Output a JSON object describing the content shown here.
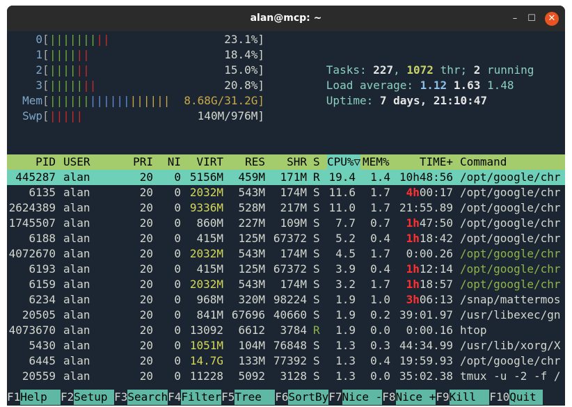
{
  "window": {
    "title": "alan@mcp: ~",
    "minimize": "–",
    "maximize": "☐",
    "close": "✕"
  },
  "meters": {
    "cpu": [
      {
        "id": "0",
        "green": "|||||||",
        "red": "||",
        "value": "23.1%]"
      },
      {
        "id": "1",
        "green": "||||",
        "red": "||",
        "value": "18.4%]"
      },
      {
        "id": "2",
        "green": "||||",
        "red": "||",
        "value": "15.0%]"
      },
      {
        "id": "3",
        "green": "|||||",
        "red": "||",
        "value": "20.8%]"
      }
    ],
    "mem": {
      "label": "Mem",
      "bar": "||||||||||||||||||",
      "value": "8.68G/31.2G]"
    },
    "swp": {
      "label": "Swp",
      "bar": "|||||",
      "value": "140M/976M]"
    }
  },
  "summary": {
    "tasks_label": "Tasks: ",
    "tasks": "227",
    "sep1": ", ",
    "threads": "1072",
    "thr": " thr; ",
    "running": "2",
    "running_label": " running",
    "load_label": "Load average: ",
    "load1": "1.12",
    "load5": "1.63",
    "load15": "1.48",
    "uptime_label": "Uptime: ",
    "uptime": "7 days, 21:10:47"
  },
  "columns": [
    "PID",
    "USER",
    "PRI",
    "NI",
    "VIRT",
    "RES",
    "SHR",
    "S",
    "CPU%▽",
    "MEM%",
    "TIME+",
    "Command"
  ],
  "processes": [
    {
      "pid": "445287",
      "user": "alan",
      "pri": "20",
      "ni": "0",
      "virt": "5156M",
      "res": "459M",
      "shr": "171M",
      "s": "R",
      "cpu": "19.4",
      "mem": "1.4",
      "time_a": "10h48:56",
      "time_b": "",
      "cmd": "/opt/google/chr"
    },
    {
      "pid": "6135",
      "user": "alan",
      "pri": "20",
      "ni": "0",
      "virt": "2032M",
      "res": "543M",
      "shr": "174M",
      "s": "S",
      "cpu": "11.6",
      "mem": "1.7",
      "time_a": "4h",
      "time_b": "00:17",
      "cmd": "/opt/google/chr"
    },
    {
      "pid": "2624389",
      "user": "alan",
      "pri": "20",
      "ni": "0",
      "virt": "9336M",
      "res": "528M",
      "shr": "217M",
      "s": "S",
      "cpu": "11.0",
      "mem": "1.7",
      "time_a": "",
      "time_b": "21:55.89",
      "cmd": "/opt/google/chr"
    },
    {
      "pid": "1745507",
      "user": "alan",
      "pri": "20",
      "ni": "0",
      "virt": "860M",
      "res": "227M",
      "shr": "109M",
      "s": "S",
      "cpu": "7.7",
      "mem": "0.7",
      "time_a": "1h",
      "time_b": "47:50",
      "cmd": "/opt/google/chr"
    },
    {
      "pid": "6188",
      "user": "alan",
      "pri": "20",
      "ni": "0",
      "virt": "415M",
      "res": "125M",
      "shr": "67372",
      "s": "S",
      "cpu": "5.2",
      "mem": "0.4",
      "time_a": "1h",
      "time_b": "18:42",
      "cmd": "/opt/google/chr"
    },
    {
      "pid": "4072670",
      "user": "alan",
      "pri": "20",
      "ni": "0",
      "virt": "2032M",
      "res": "543M",
      "shr": "174M",
      "s": "S",
      "cpu": "4.5",
      "mem": "1.7",
      "time_a": "",
      "time_b": "0:00.26",
      "cmd": "/opt/google/chr"
    },
    {
      "pid": "6193",
      "user": "alan",
      "pri": "20",
      "ni": "0",
      "virt": "415M",
      "res": "125M",
      "shr": "67372",
      "s": "S",
      "cpu": "3.9",
      "mem": "0.4",
      "time_a": "1h",
      "time_b": "12:14",
      "cmd": "/opt/google/chr"
    },
    {
      "pid": "6159",
      "user": "alan",
      "pri": "20",
      "ni": "0",
      "virt": "2032M",
      "res": "543M",
      "shr": "174M",
      "s": "S",
      "cpu": "3.2",
      "mem": "1.7",
      "time_a": "1h",
      "time_b": "18:57",
      "cmd": "/opt/google/chr"
    },
    {
      "pid": "6234",
      "user": "alan",
      "pri": "20",
      "ni": "0",
      "virt": "968M",
      "res": "320M",
      "shr": "98224",
      "s": "S",
      "cpu": "1.9",
      "mem": "1.0",
      "time_a": "3h",
      "time_b": "06:13",
      "cmd": "/snap/mattermos"
    },
    {
      "pid": "20505",
      "user": "alan",
      "pri": "20",
      "ni": "0",
      "virt": "841M",
      "res": "67696",
      "shr": "40660",
      "s": "S",
      "cpu": "1.9",
      "mem": "0.2",
      "time_a": "",
      "time_b": "39:01.97",
      "cmd": "/usr/libexec/gn"
    },
    {
      "pid": "4073670",
      "user": "alan",
      "pri": "20",
      "ni": "0",
      "virt": "13092",
      "res": "6612",
      "shr": "3784",
      "s": "R",
      "cpu": "1.9",
      "mem": "0.0",
      "time_a": "",
      "time_b": "0:00.16",
      "cmd": "htop"
    },
    {
      "pid": "5430",
      "user": "alan",
      "pri": "20",
      "ni": "0",
      "virt": "1051M",
      "res": "104M",
      "shr": "76848",
      "s": "S",
      "cpu": "1.3",
      "mem": "0.3",
      "time_a": "",
      "time_b": "44:34.99",
      "cmd": "/usr/lib/xorg/X"
    },
    {
      "pid": "6445",
      "user": "alan",
      "pri": "20",
      "ni": "0",
      "virt": "14.7G",
      "res": "133M",
      "shr": "77392",
      "s": "S",
      "cpu": "1.3",
      "mem": "0.4",
      "time_a": "",
      "time_b": "19:59.93",
      "cmd": "/opt/google/chr"
    },
    {
      "pid": "20559",
      "user": "alan",
      "pri": "20",
      "ni": "0",
      "virt": "11228",
      "res": "5092",
      "shr": "3128",
      "s": "S",
      "cpu": "1.3",
      "mem": "0.0",
      "time_a": "",
      "time_b": "35:02.38",
      "cmd": "tmux -u -2 -f /"
    }
  ],
  "function_keys": [
    {
      "key": "F1",
      "label": "Help  "
    },
    {
      "key": "F2",
      "label": "Setup "
    },
    {
      "key": "F3",
      "label": "Search"
    },
    {
      "key": "F4",
      "label": "Filter"
    },
    {
      "key": "F5",
      "label": "Tree  "
    },
    {
      "key": "F6",
      "label": "SortBy"
    },
    {
      "key": "F7",
      "label": "Nice -"
    },
    {
      "key": "F8",
      "label": "Nice +"
    },
    {
      "key": "F9",
      "label": "Kill  "
    },
    {
      "key": "F10",
      "label": "Quit "
    }
  ],
  "colors": {
    "header_bg": "#a4cc6d",
    "selected_bg": "#6fd0b9",
    "terminal_bg": "#1c2632",
    "close_button": "#e95420"
  }
}
